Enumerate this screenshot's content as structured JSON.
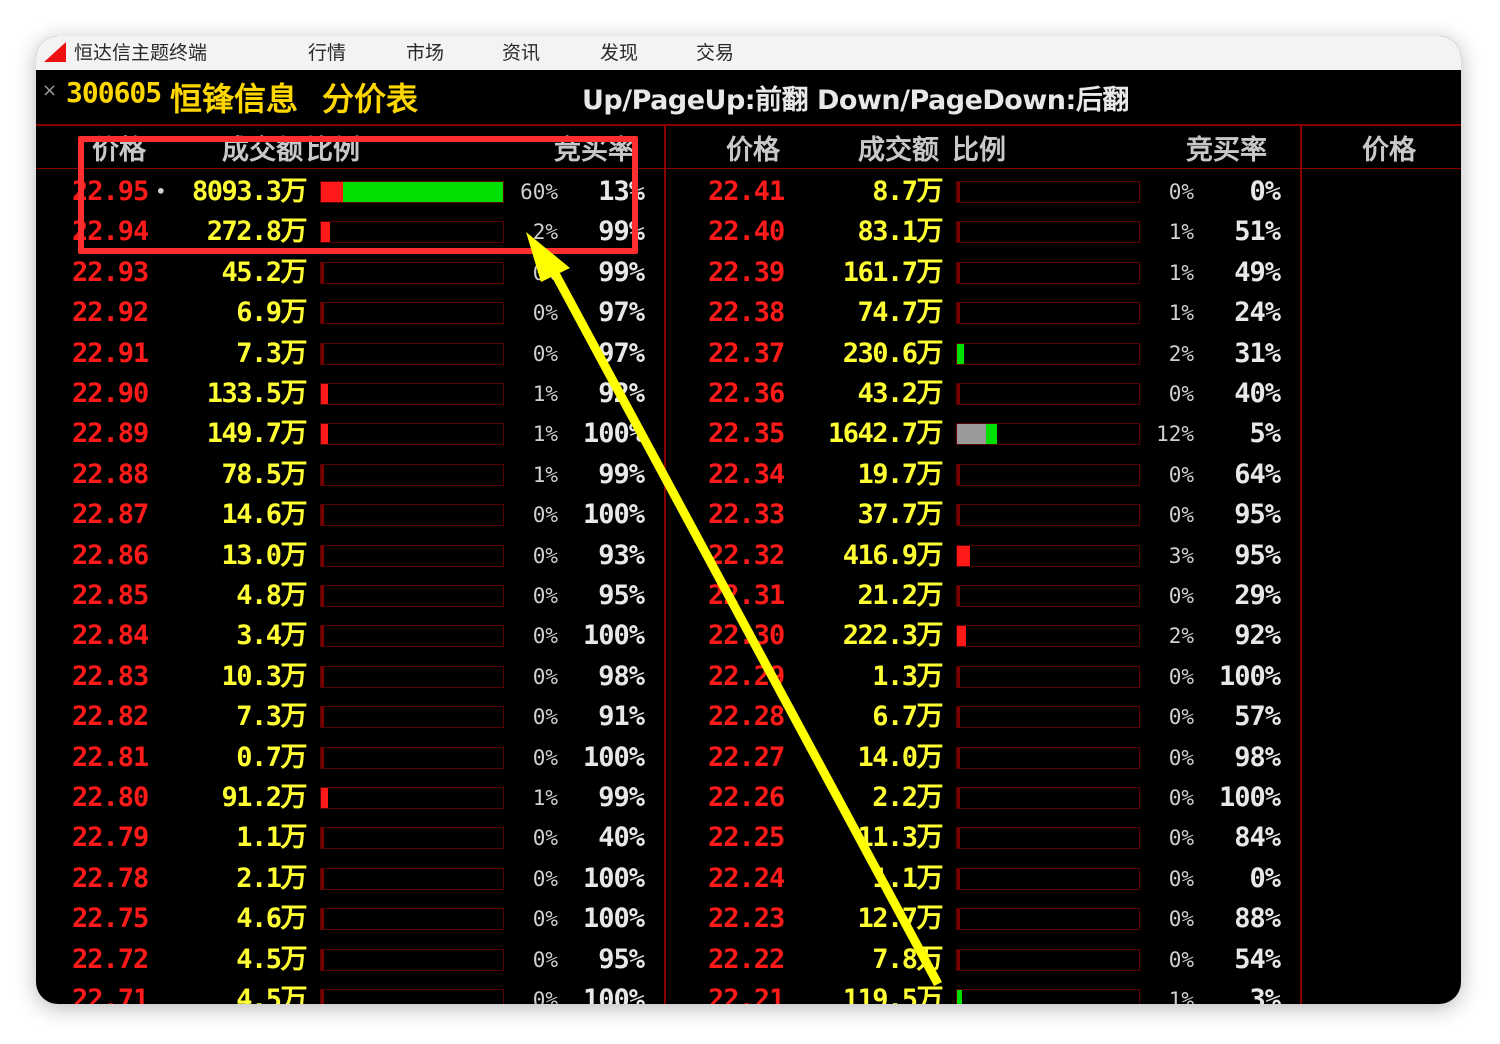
{
  "menu": {
    "app_name": "恒达信主题终端",
    "items": [
      "行情",
      "市场",
      "资讯",
      "发现",
      "交易"
    ]
  },
  "titlebar": {
    "close_glyph": "×",
    "stock_code": "300605",
    "stock_name": "恒锋信息",
    "page_title": "分价表",
    "paging_hint": "Up/PageUp:前翻 Down/PageDown:后翻"
  },
  "columns": {
    "price": "价格",
    "amount": "成交额",
    "ratio": "比例",
    "buy_rate": "竞买率"
  },
  "colors": {
    "price_red": "#ff1a1a",
    "amount_yellow": "#ffff33",
    "bar_red": "#ff1a1a",
    "bar_green": "#00e000",
    "bar_gray": "#9a9a9a",
    "highlight_red": "#ff2f2f",
    "arrow_yellow": "#ffff00"
  },
  "left_table": [
    {
      "price": "22.95",
      "marker": "•",
      "amount": "8093.3万",
      "ratio_pct": "60%",
      "buy_rate": "13%",
      "bar": {
        "red": 0.12,
        "green": 0.88
      }
    },
    {
      "price": "22.94",
      "marker": "",
      "amount": "272.8万",
      "ratio_pct": "2%",
      "buy_rate": "99%",
      "bar": {
        "red": 0.05
      }
    },
    {
      "price": "22.93",
      "marker": "",
      "amount": "45.2万",
      "ratio_pct": "0%",
      "buy_rate": "99%",
      "bar": {}
    },
    {
      "price": "22.92",
      "marker": "",
      "amount": "6.9万",
      "ratio_pct": "0%",
      "buy_rate": "97%",
      "bar": {}
    },
    {
      "price": "22.91",
      "marker": "",
      "amount": "7.3万",
      "ratio_pct": "0%",
      "buy_rate": "97%",
      "bar": {}
    },
    {
      "price": "22.90",
      "marker": "",
      "amount": "133.5万",
      "ratio_pct": "1%",
      "buy_rate": "92%",
      "bar": {
        "red": 0.04
      }
    },
    {
      "price": "22.89",
      "marker": "",
      "amount": "149.7万",
      "ratio_pct": "1%",
      "buy_rate": "100%",
      "bar": {
        "red": 0.04
      }
    },
    {
      "price": "22.88",
      "marker": "",
      "amount": "78.5万",
      "ratio_pct": "1%",
      "buy_rate": "99%",
      "bar": {}
    },
    {
      "price": "22.87",
      "marker": "",
      "amount": "14.6万",
      "ratio_pct": "0%",
      "buy_rate": "100%",
      "bar": {}
    },
    {
      "price": "22.86",
      "marker": "",
      "amount": "13.0万",
      "ratio_pct": "0%",
      "buy_rate": "93%",
      "bar": {}
    },
    {
      "price": "22.85",
      "marker": "",
      "amount": "4.8万",
      "ratio_pct": "0%",
      "buy_rate": "95%",
      "bar": {}
    },
    {
      "price": "22.84",
      "marker": "",
      "amount": "3.4万",
      "ratio_pct": "0%",
      "buy_rate": "100%",
      "bar": {}
    },
    {
      "price": "22.83",
      "marker": "",
      "amount": "10.3万",
      "ratio_pct": "0%",
      "buy_rate": "98%",
      "bar": {}
    },
    {
      "price": "22.82",
      "marker": "",
      "amount": "7.3万",
      "ratio_pct": "0%",
      "buy_rate": "91%",
      "bar": {}
    },
    {
      "price": "22.81",
      "marker": "",
      "amount": "0.7万",
      "ratio_pct": "0%",
      "buy_rate": "100%",
      "bar": {}
    },
    {
      "price": "22.80",
      "marker": "",
      "amount": "91.2万",
      "ratio_pct": "1%",
      "buy_rate": "99%",
      "bar": {
        "red": 0.04
      }
    },
    {
      "price": "22.79",
      "marker": "",
      "amount": "1.1万",
      "ratio_pct": "0%",
      "buy_rate": "40%",
      "bar": {}
    },
    {
      "price": "22.78",
      "marker": "",
      "amount": "2.1万",
      "ratio_pct": "0%",
      "buy_rate": "100%",
      "bar": {}
    },
    {
      "price": "22.75",
      "marker": "",
      "amount": "4.6万",
      "ratio_pct": "0%",
      "buy_rate": "100%",
      "bar": {}
    },
    {
      "price": "22.72",
      "marker": "",
      "amount": "4.5万",
      "ratio_pct": "0%",
      "buy_rate": "95%",
      "bar": {}
    },
    {
      "price": "22.71",
      "marker": "",
      "amount": "4.5万",
      "ratio_pct": "0%",
      "buy_rate": "100%",
      "bar": {}
    }
  ],
  "right_table": [
    {
      "price": "22.41",
      "amount": "8.7万",
      "ratio_pct": "0%",
      "buy_rate": "0%",
      "bar": {}
    },
    {
      "price": "22.40",
      "amount": "83.1万",
      "ratio_pct": "1%",
      "buy_rate": "51%",
      "bar": {}
    },
    {
      "price": "22.39",
      "amount": "161.7万",
      "ratio_pct": "1%",
      "buy_rate": "49%",
      "bar": {}
    },
    {
      "price": "22.38",
      "amount": "74.7万",
      "ratio_pct": "1%",
      "buy_rate": "24%",
      "bar": {}
    },
    {
      "price": "22.37",
      "amount": "230.6万",
      "ratio_pct": "2%",
      "buy_rate": "31%",
      "bar": {
        "green": 0.04
      }
    },
    {
      "price": "22.36",
      "amount": "43.2万",
      "ratio_pct": "0%",
      "buy_rate": "40%",
      "bar": {}
    },
    {
      "price": "22.35",
      "amount": "1642.7万",
      "ratio_pct": "12%",
      "buy_rate": "5%",
      "bar": {
        "gray": 0.16,
        "green": 0.06
      }
    },
    {
      "price": "22.34",
      "amount": "19.7万",
      "ratio_pct": "0%",
      "buy_rate": "64%",
      "bar": {}
    },
    {
      "price": "22.33",
      "amount": "37.7万",
      "ratio_pct": "0%",
      "buy_rate": "95%",
      "bar": {}
    },
    {
      "price": "22.32",
      "amount": "416.9万",
      "ratio_pct": "3%",
      "buy_rate": "95%",
      "bar": {
        "red": 0.07
      }
    },
    {
      "price": "22.31",
      "amount": "21.2万",
      "ratio_pct": "0%",
      "buy_rate": "29%",
      "bar": {}
    },
    {
      "price": "22.30",
      "amount": "222.3万",
      "ratio_pct": "2%",
      "buy_rate": "92%",
      "bar": {
        "red": 0.05
      }
    },
    {
      "price": "22.29",
      "amount": "1.3万",
      "ratio_pct": "0%",
      "buy_rate": "100%",
      "bar": {}
    },
    {
      "price": "22.28",
      "amount": "6.7万",
      "ratio_pct": "0%",
      "buy_rate": "57%",
      "bar": {}
    },
    {
      "price": "22.27",
      "amount": "14.0万",
      "ratio_pct": "0%",
      "buy_rate": "98%",
      "bar": {}
    },
    {
      "price": "22.26",
      "amount": "2.2万",
      "ratio_pct": "0%",
      "buy_rate": "100%",
      "bar": {}
    },
    {
      "price": "22.25",
      "amount": "11.3万",
      "ratio_pct": "0%",
      "buy_rate": "84%",
      "bar": {}
    },
    {
      "price": "22.24",
      "amount": "1.1万",
      "ratio_pct": "0%",
      "buy_rate": "0%",
      "bar": {}
    },
    {
      "price": "22.23",
      "amount": "12.7万",
      "ratio_pct": "0%",
      "buy_rate": "88%",
      "bar": {}
    },
    {
      "price": "22.22",
      "amount": "7.8万",
      "ratio_pct": "0%",
      "buy_rate": "54%",
      "bar": {}
    },
    {
      "price": "22.21",
      "amount": "119.5万",
      "ratio_pct": "1%",
      "buy_rate": "3%",
      "bar": {
        "green": 0.03
      }
    }
  ]
}
